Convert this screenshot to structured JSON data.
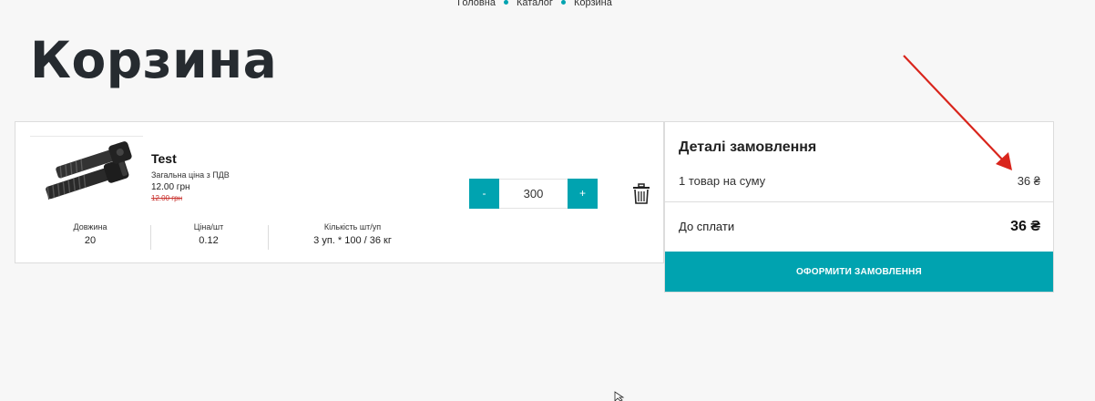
{
  "breadcrumb": {
    "items": [
      "Головна",
      "Каталог",
      "Корзина"
    ]
  },
  "page": {
    "title": "Корзина"
  },
  "cart": {
    "item": {
      "name": "Test",
      "price_caption": "Загальна ціна з ПДВ",
      "price_current": "12.00 грн",
      "price_old": "12.00 грн",
      "image_icon": "bolts-product-image",
      "quantity": "300",
      "minus_label": "-",
      "plus_label": "+",
      "delete_icon": "trash-icon",
      "specs": [
        {
          "label": "Довжина",
          "value": "20"
        },
        {
          "label": "Ціна/шт",
          "value": "0.12"
        },
        {
          "label": "Кількість шт/уп",
          "value": "3 уп. * 100 / 36 кг"
        }
      ]
    }
  },
  "summary": {
    "title": "Деталі замовлення",
    "items_label": "1 товар на суму",
    "items_value": "36 ₴",
    "total_label": "До сплати",
    "total_value": "36 ₴",
    "checkout_label": "Оформити замовлення"
  },
  "colors": {
    "accent": "#00a3b0",
    "annotation_arrow": "#d9251c",
    "old_price": "#c9302c"
  }
}
